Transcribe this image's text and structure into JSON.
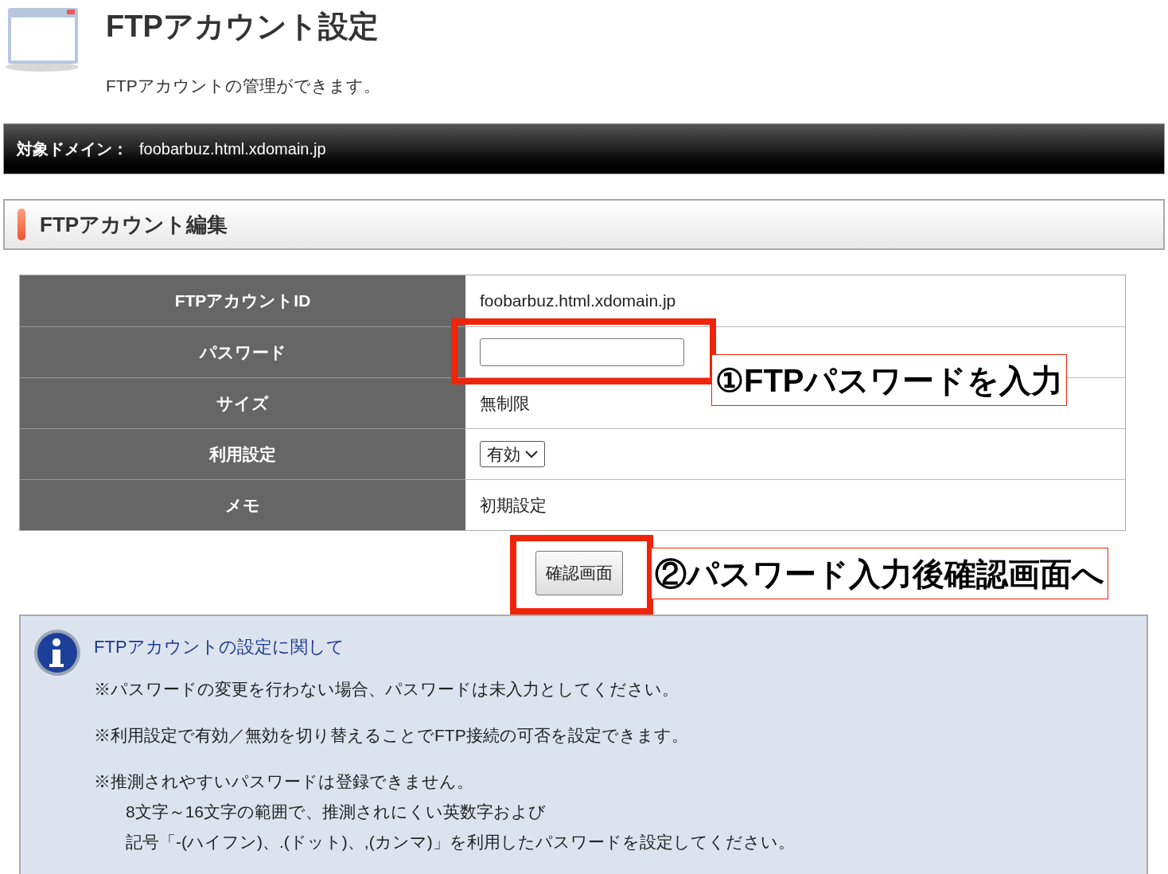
{
  "header": {
    "title": "FTPアカウント設定",
    "description": "FTPアカウントの管理ができます。"
  },
  "domain_bar": {
    "label": "対象ドメイン：",
    "value": "foobarbuz.html.xdomain.jp"
  },
  "section": {
    "title": "FTPアカウント編集"
  },
  "form": {
    "rows": [
      {
        "kind": "text",
        "label": "FTPアカウントID",
        "value": "foobarbuz.html.xdomain.jp"
      },
      {
        "kind": "password",
        "label": "パスワード"
      },
      {
        "kind": "text",
        "label": "サイズ",
        "value": "無制限"
      },
      {
        "kind": "select",
        "label": "利用設定",
        "value": "有効"
      },
      {
        "kind": "text",
        "label": "メモ",
        "value": "初期設定"
      }
    ]
  },
  "confirm_button": "確認画面",
  "annotations": [
    {
      "text": "①FTPパスワードを入力"
    },
    {
      "text": "②パスワード入力後確認画面へ"
    }
  ],
  "info": {
    "title": "FTPアカウントの設定に関して",
    "notes": [
      {
        "lines": [
          "※パスワードの変更を行わない場合、パスワードは未入力としてください。"
        ]
      },
      {
        "lines": [
          "※利用設定で有効／無効を切り替えることでFTP接続の可否を設定できます。"
        ]
      },
      {
        "lines": [
          "※推測されやすいパスワードは登録できません。",
          "8文字～16文字の範囲で、推測されにくい英数字および",
          "記号「-(ハイフン)、.(ドット)、,(カンマ)」を利用したパスワードを設定してください。"
        ]
      }
    ]
  }
}
